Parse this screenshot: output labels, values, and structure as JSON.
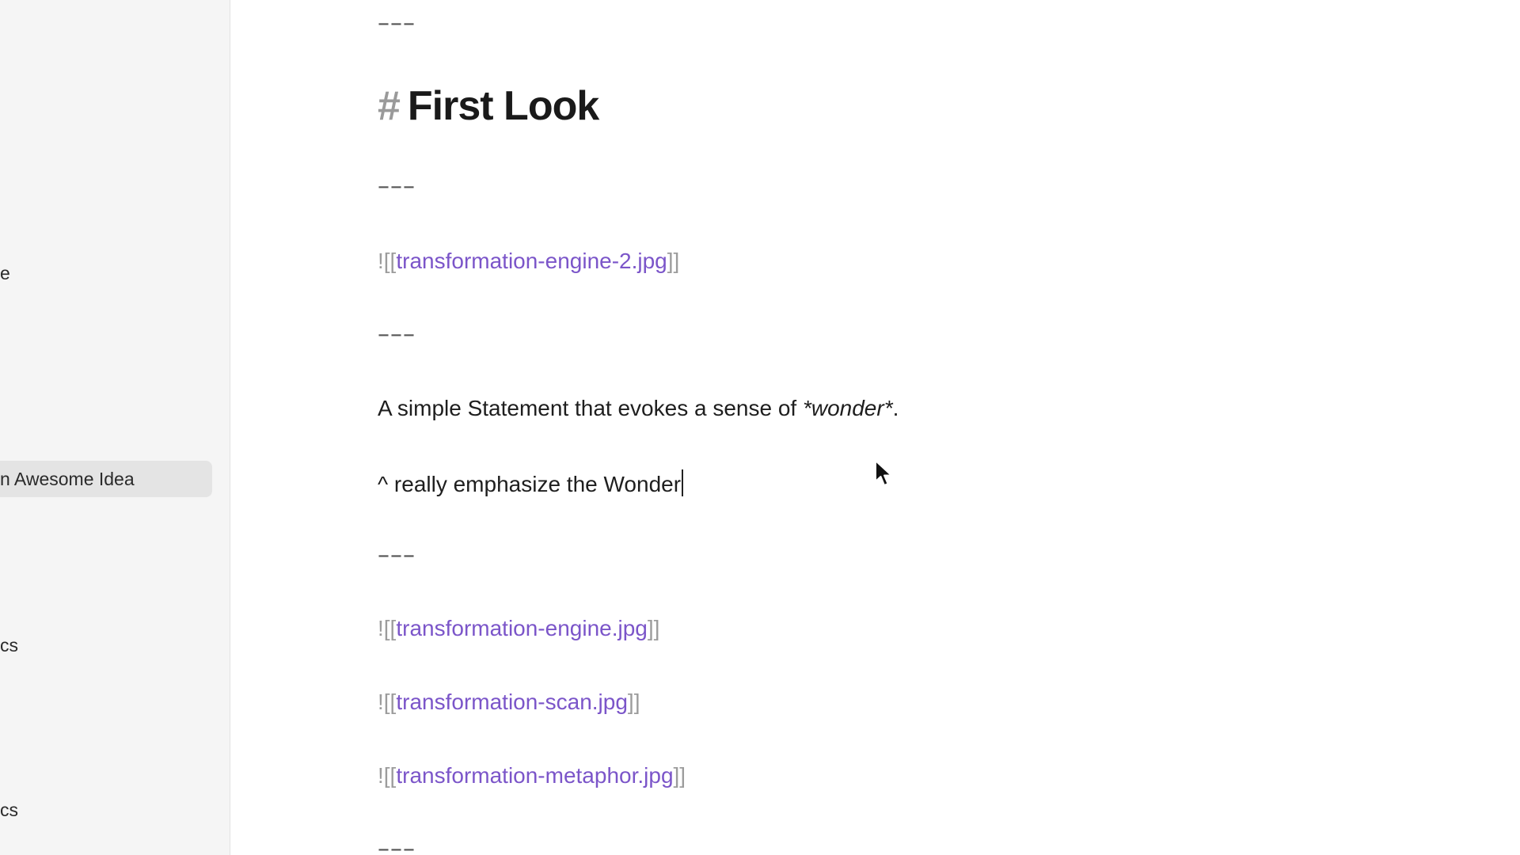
{
  "sidebar": {
    "items": [
      {
        "label": "e",
        "active": false
      },
      {
        "label": "n Awesome Idea",
        "active": true
      },
      {
        "label": "cs",
        "active": false
      },
      {
        "label": "cs",
        "active": false
      }
    ]
  },
  "editor": {
    "hr_text": "–––",
    "heading": {
      "hash": "#",
      "text": "First Look"
    },
    "embed_prefix": "![[",
    "embed_suffix": "]]",
    "embeds": [
      "transformation-engine-2.jpg",
      "transformation-engine.jpg",
      "transformation-scan.jpg",
      "transformation-metaphor.jpg"
    ],
    "statement": {
      "before": "A simple Statement that evokes a sense of ",
      "emphasis": "*wonder*",
      "after": "."
    },
    "note": "^ really emphasize the Wonder"
  },
  "colors": {
    "link": "#7b55c9",
    "bracket": "#9c9c9c",
    "sidebar_bg": "#f5f5f5",
    "active_item_bg": "#e4e4e4"
  },
  "icons": {
    "mouse_cursor": "arrow-pointer-icon"
  }
}
